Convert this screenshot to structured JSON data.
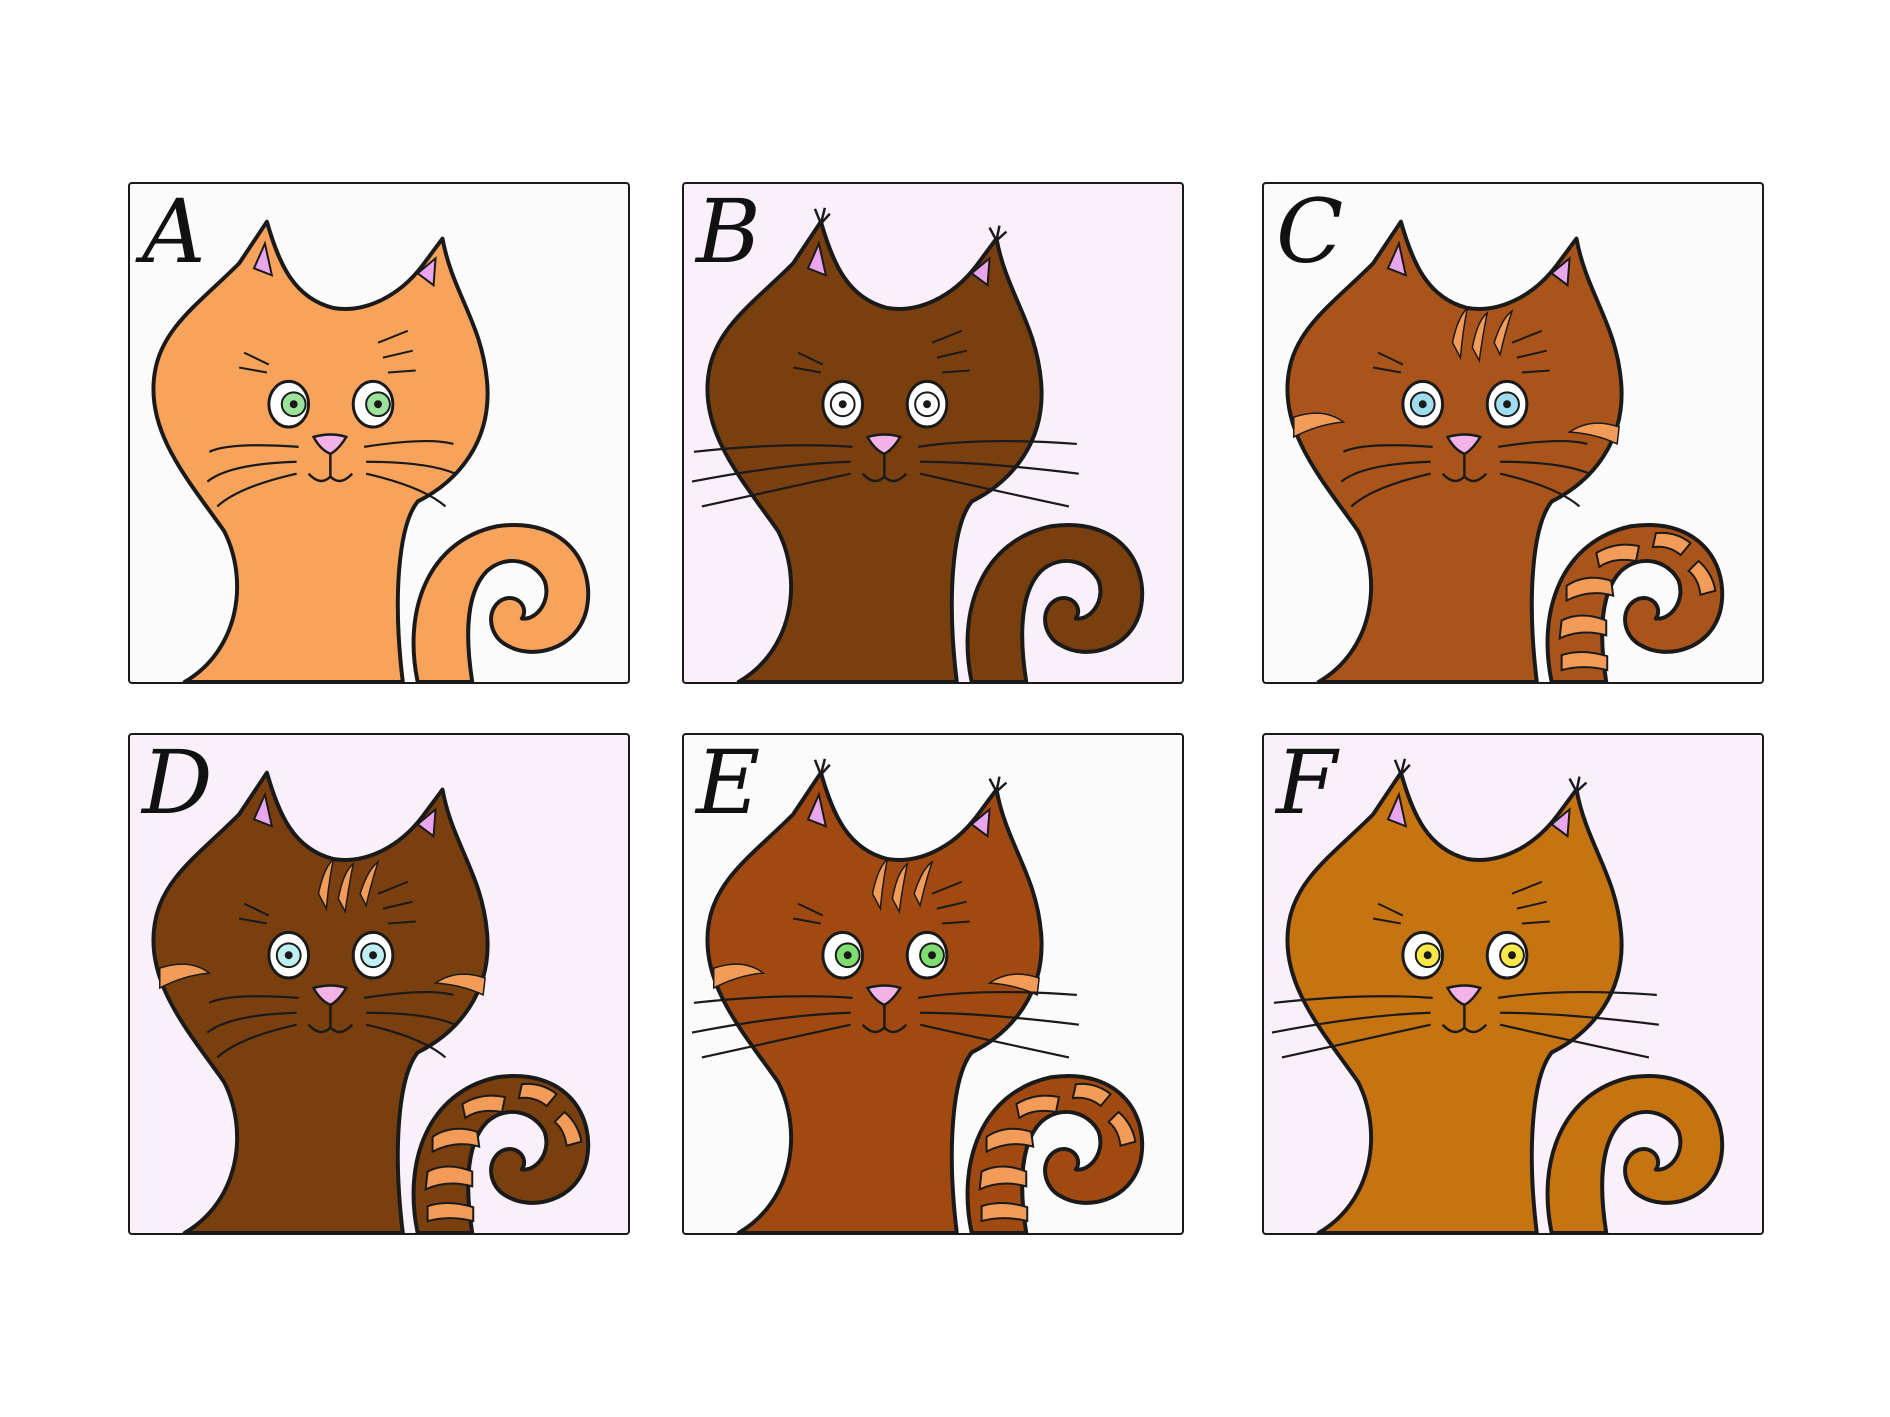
{
  "panels": [
    {
      "label": "A",
      "bg": "#fbfbfb",
      "fur": "#f7a35c",
      "tail_stripe": "",
      "eye": "#9be39b",
      "pupil": "dir-right",
      "stripes": false,
      "tufts": false,
      "whisker_out": false,
      "patches": false
    },
    {
      "label": "B",
      "bg": "#f9f0fa",
      "fur": "#7a3f0e",
      "tail_stripe": "",
      "eye": "#ffffff",
      "pupil": "center",
      "stripes": false,
      "tufts": true,
      "whisker_out": true,
      "patches": false
    },
    {
      "label": "C",
      "bg": "#fbfbfb",
      "fur": "#a9541a",
      "tail_stripe": "#f39b58",
      "eye": "#9fdcef",
      "pupil": "center",
      "stripes": true,
      "tufts": false,
      "whisker_out": false,
      "patches": true
    },
    {
      "label": "D",
      "bg": "#f9f0fa",
      "fur": "#7a3f0e",
      "tail_stripe": "#f39b58",
      "eye": "#bfeff0",
      "pupil": "center",
      "stripes": true,
      "tufts": false,
      "whisker_out": false,
      "patches": true
    },
    {
      "label": "E",
      "bg": "#fbfbfb",
      "fur": "#a04a12",
      "tail_stripe": "#f39b58",
      "eye": "#7fdc6f",
      "pupil": "dir-right",
      "stripes": true,
      "tufts": true,
      "whisker_out": true,
      "patches": true
    },
    {
      "label": "F",
      "bg": "#f9f0fa",
      "fur": "#c67312",
      "tail_stripe": "",
      "eye": "#f7e84a",
      "pupil": "dir-right",
      "stripes": false,
      "tufts": true,
      "whisker_out": true,
      "patches": false
    }
  ],
  "colors": {
    "outline": "#1a1a1a",
    "ear_inner": "#e9a6ec",
    "nose": "#f3b3e6"
  }
}
